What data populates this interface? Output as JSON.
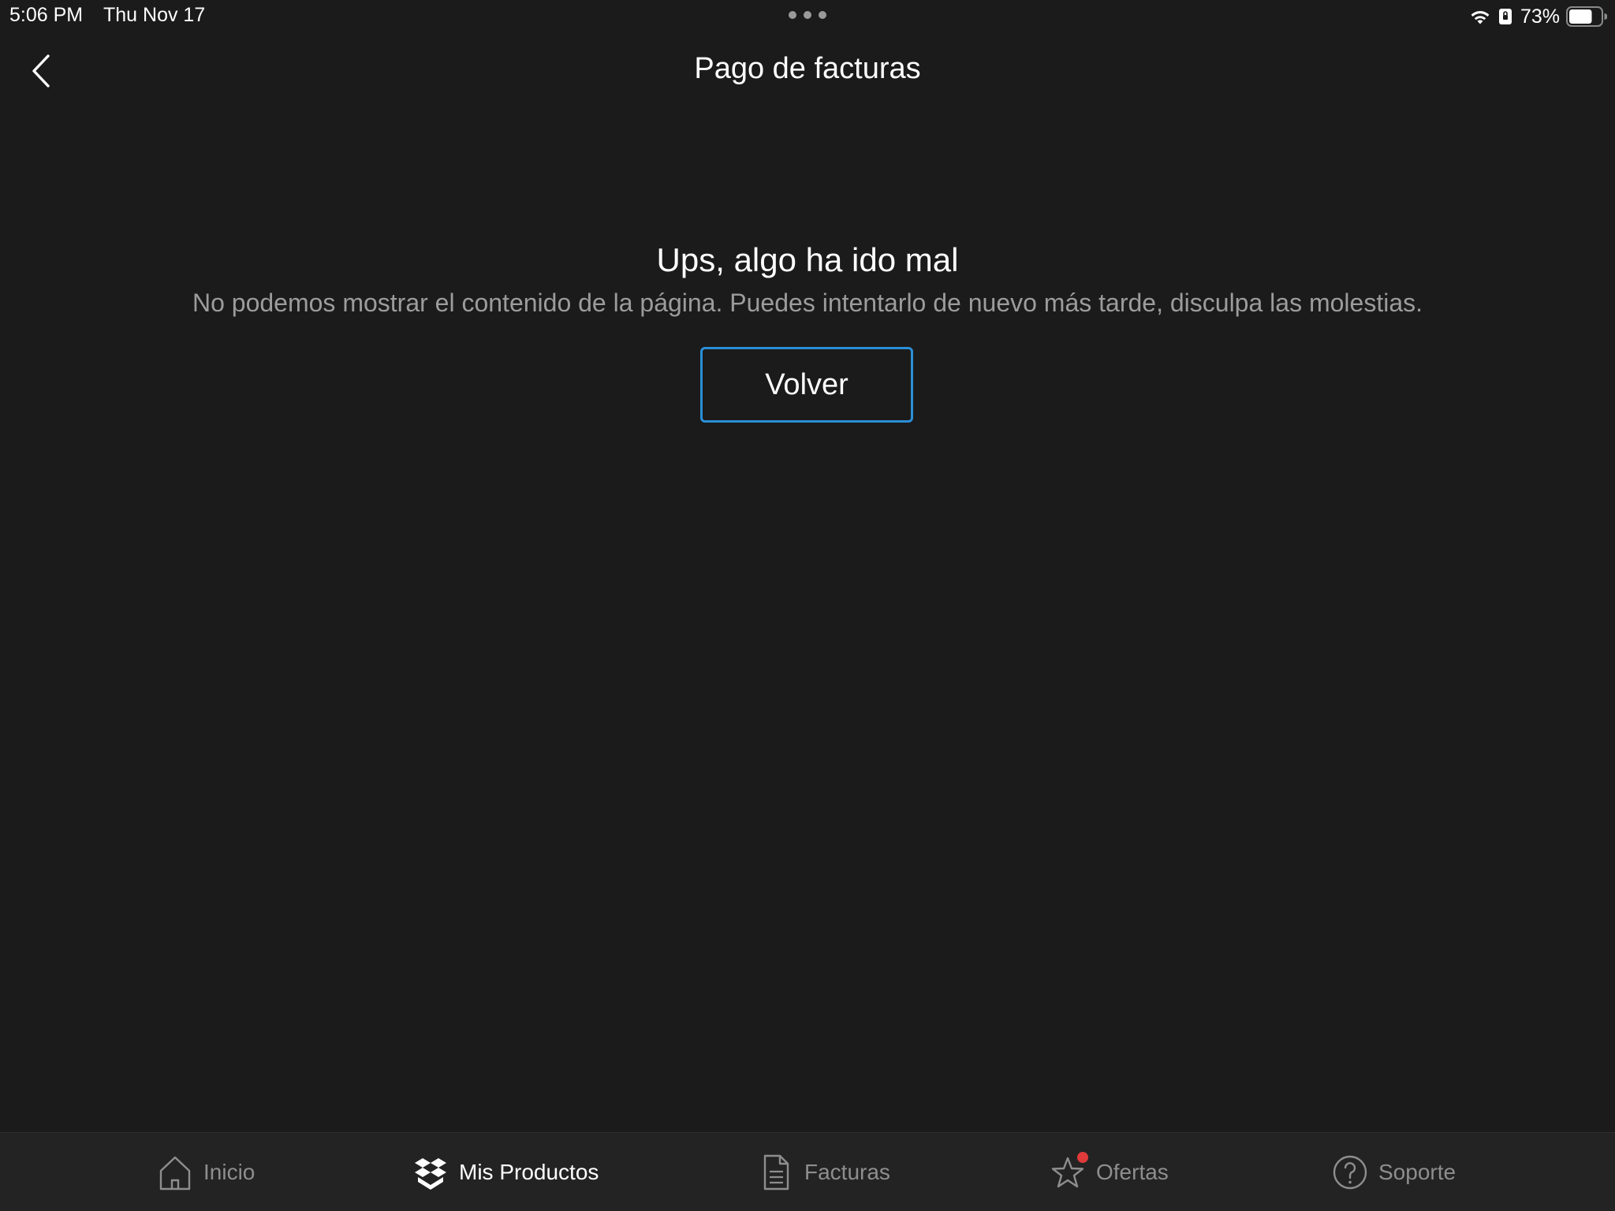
{
  "status_bar": {
    "time": "5:06 PM",
    "date": "Thu Nov 17",
    "battery_percent": "73%",
    "battery_level": 0.73
  },
  "header": {
    "title": "Pago de facturas",
    "back_icon": "chevron-left-icon"
  },
  "error": {
    "title": "Ups, algo ha ido mal",
    "message": "No podemos mostrar el contenido de la página. Puedes intentarlo de nuevo más tarde, disculpa las molestias.",
    "button_label": "Volver"
  },
  "tab_bar": {
    "tabs": [
      {
        "label": "Inicio",
        "icon": "home-icon",
        "active": false
      },
      {
        "label": "Mis Productos",
        "icon": "boxes-icon",
        "active": true
      },
      {
        "label": "Facturas",
        "icon": "document-icon",
        "active": false
      },
      {
        "label": "Ofertas",
        "icon": "star-icon",
        "active": false,
        "badge": true
      },
      {
        "label": "Soporte",
        "icon": "question-circle-icon",
        "active": false
      }
    ]
  },
  "colors": {
    "background": "#1b1b1b",
    "tab_bar_background": "#232323",
    "accent_border": "#2b8fd6",
    "secondary_text": "#9c9c9c",
    "badge": "#e03a3a"
  }
}
